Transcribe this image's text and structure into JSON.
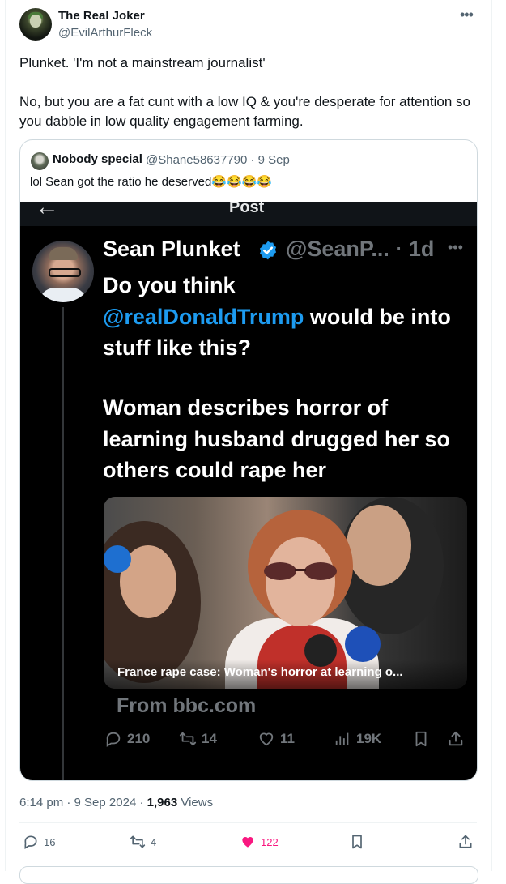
{
  "tweet": {
    "author_name": "The Real Joker",
    "author_handle": "@EvilArthurFleck",
    "paragraph1": "Plunket. 'I'm not a mainstream journalist'",
    "paragraph2": "No, but you are a fat cunt with a low IQ & you're desperate for attention so you dabble in low quality engagement farming.",
    "time": "6:14 pm",
    "date": "9 Sep 2024",
    "views_count": "1,963",
    "views_label": "Views",
    "actions": {
      "replies": "16",
      "reposts": "4",
      "likes": "122"
    }
  },
  "quote": {
    "author_name": "Nobody special",
    "author_handle": "@Shane58637790 · 9 Sep",
    "text": "lol Sean got the ratio he deserved😂😂😂😂"
  },
  "screenshot": {
    "header_title": "Post",
    "author_name": "Sean Plunket",
    "author_handle": "@SeanP... · 1d",
    "text_pre": "Do you think",
    "mention": "@realDonaldTrump",
    "text_post": "would be into stuff like this?",
    "headline": "Woman describes horror of learning husband drugged her so others could rape her",
    "card_caption": "France rape case: Woman's horror at learning o...",
    "source": "From bbc.com",
    "actions": {
      "replies": "210",
      "reposts": "14",
      "likes": "11",
      "views": "19K"
    }
  },
  "colors": {
    "accent": "#1d9bf0",
    "like": "#f91880",
    "secondary_text": "#536471"
  },
  "icons": [
    "more-icon",
    "verified-icon",
    "reply-icon",
    "repost-icon",
    "like-icon",
    "views-icon",
    "bookmark-icon",
    "share-icon",
    "back-arrow-icon"
  ]
}
